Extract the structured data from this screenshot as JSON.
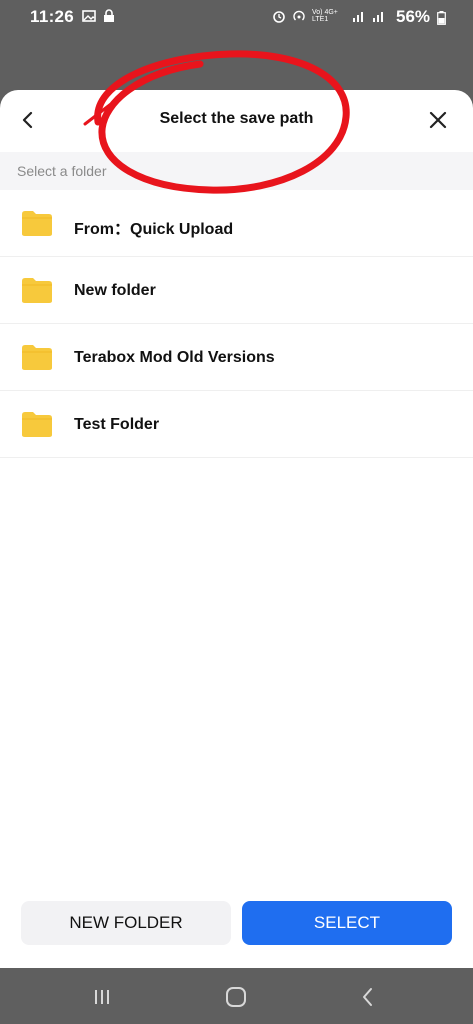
{
  "status_bar": {
    "time": "11:26",
    "battery": "56%",
    "network_label": "Vo) 4G+ LTE1"
  },
  "dialog": {
    "title": "Select the save path",
    "subheader": "Select a folder",
    "folders": [
      {
        "label": "From：Quick Upload"
      },
      {
        "label": "New folder"
      },
      {
        "label": "Terabox Mod Old Versions"
      },
      {
        "label": "Test Folder"
      }
    ],
    "buttons": {
      "new_folder": "NEW FOLDER",
      "select": "SELECT"
    }
  },
  "colors": {
    "accent": "#1f6ef0",
    "folder": "#f7c93c",
    "annotation": "#e8141c",
    "overlay": "#5f5f5f"
  },
  "icons": {
    "back": "chevron-left-icon",
    "close": "close-icon",
    "folder": "folder-icon",
    "nav_recent": "recent-apps-icon",
    "nav_home": "home-icon",
    "nav_back": "back-icon"
  }
}
